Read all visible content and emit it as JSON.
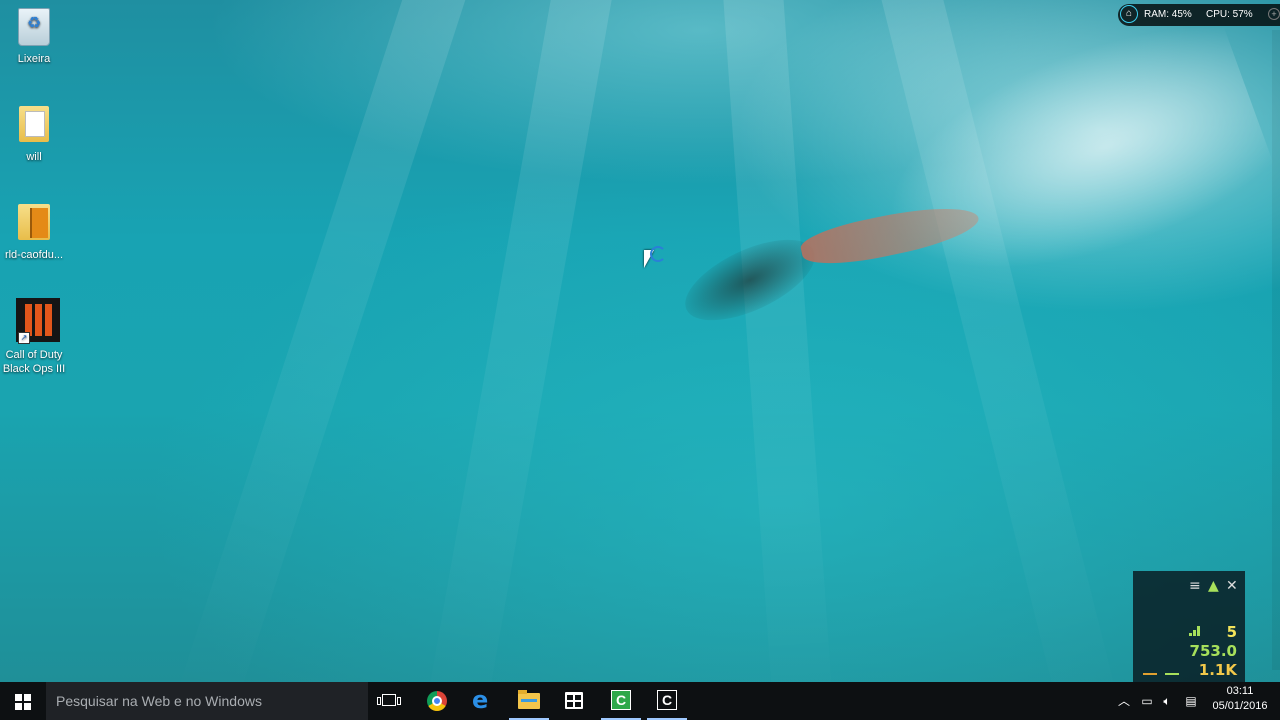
{
  "desktop": {
    "icons": [
      {
        "label": "Lixeira"
      },
      {
        "label": "will"
      },
      {
        "label": "rld-caofdu..."
      },
      {
        "label": "Call of Duty Black Ops III"
      }
    ]
  },
  "system_monitor": {
    "ram": "RAM: 45%",
    "cpu": "CPU: 57%"
  },
  "perf_widget": {
    "ping": "5",
    "value_mid": "753.0",
    "value_bottom": "1.1K",
    "colors": {
      "ping": "#f2e35a",
      "mid": "#a7e05b",
      "bottom": "#f2c84a"
    }
  },
  "taskbar": {
    "search_placeholder": "Pesquisar na Web e no Windows",
    "pinned": [
      "task-view-icon",
      "chrome-icon",
      "edge-icon",
      "file-explorer-icon",
      "store-icon",
      "camtasia-icon",
      "camtasia-recorder-icon"
    ]
  },
  "tray": {
    "time": "03:11",
    "date": "05/01/2016"
  }
}
